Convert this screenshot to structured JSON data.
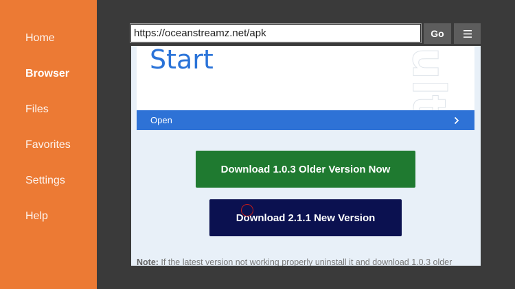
{
  "sidebar": {
    "items": [
      {
        "label": "Home",
        "active": false
      },
      {
        "label": "Browser",
        "active": true
      },
      {
        "label": "Files",
        "active": false
      },
      {
        "label": "Favorites",
        "active": false
      },
      {
        "label": "Settings",
        "active": false
      },
      {
        "label": "Help",
        "active": false
      }
    ]
  },
  "toolbar": {
    "url": "https://oceanstreamz.net/apk",
    "go_label": "Go",
    "menu_icon": "hamburger-icon"
  },
  "page": {
    "card_title": "Start",
    "watermark_text": "ultimate",
    "open_label": "Open",
    "open_chevron": "chevron-right-icon",
    "download_old_label": "Download 1.0.3 Older Version Now",
    "download_new_label": "Download 2.1.1 New Version",
    "note_label": "Note:",
    "note_text": " If the latest version not working properly uninstall it and download 1.0.3 older"
  },
  "colors": {
    "sidebar_bg": "#ec7a34",
    "open_bar": "#2e72d6",
    "download_old_bg": "#1f7a30",
    "download_new_bg": "#0b1150"
  }
}
